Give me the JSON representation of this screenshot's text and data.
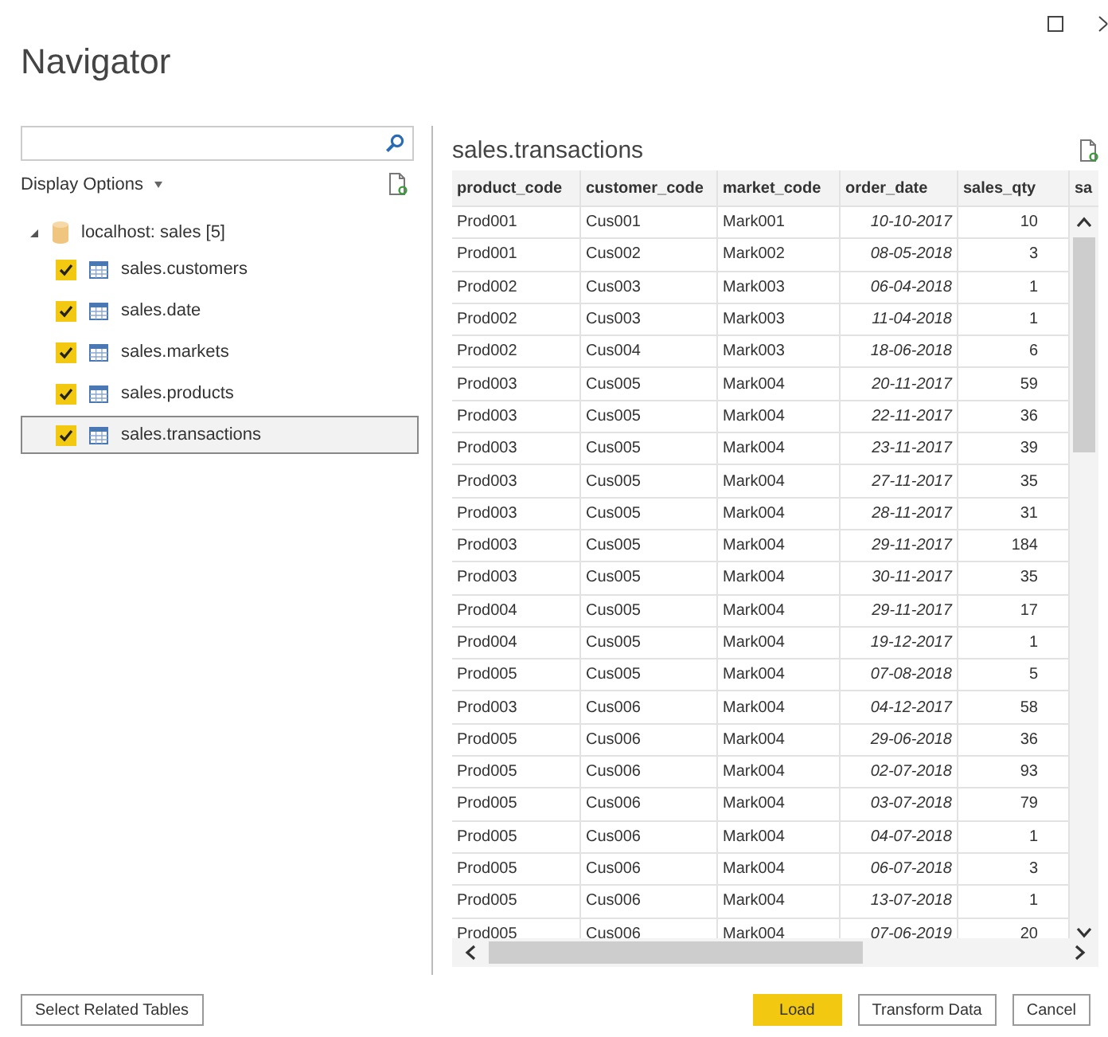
{
  "window": {
    "title": "Navigator"
  },
  "left_panel": {
    "display_options": "Display Options",
    "tree": {
      "label": "localhost: sales [5]",
      "expanded": true,
      "children": [
        {
          "label": "sales.customers",
          "checked": true,
          "selected": false
        },
        {
          "label": "sales.date",
          "checked": true,
          "selected": false
        },
        {
          "label": "sales.markets",
          "checked": true,
          "selected": false
        },
        {
          "label": "sales.products",
          "checked": true,
          "selected": false
        },
        {
          "label": "sales.transactions",
          "checked": true,
          "selected": true
        }
      ]
    }
  },
  "preview": {
    "title": "sales.transactions",
    "table": {
      "columns": [
        "product_code",
        "customer_code",
        "market_code",
        "order_date",
        "sales_qty",
        "sa"
      ],
      "rows": [
        [
          "Prod001",
          "Cus001",
          "Mark001",
          "10-10-2017",
          "10"
        ],
        [
          "Prod001",
          "Cus002",
          "Mark002",
          "08-05-2018",
          "3"
        ],
        [
          "Prod002",
          "Cus003",
          "Mark003",
          "06-04-2018",
          "1"
        ],
        [
          "Prod002",
          "Cus003",
          "Mark003",
          "11-04-2018",
          "1"
        ],
        [
          "Prod002",
          "Cus004",
          "Mark003",
          "18-06-2018",
          "6"
        ],
        [
          "Prod003",
          "Cus005",
          "Mark004",
          "20-11-2017",
          "59"
        ],
        [
          "Prod003",
          "Cus005",
          "Mark004",
          "22-11-2017",
          "36"
        ],
        [
          "Prod003",
          "Cus005",
          "Mark004",
          "23-11-2017",
          "39"
        ],
        [
          "Prod003",
          "Cus005",
          "Mark004",
          "27-11-2017",
          "35"
        ],
        [
          "Prod003",
          "Cus005",
          "Mark004",
          "28-11-2017",
          "31"
        ],
        [
          "Prod003",
          "Cus005",
          "Mark004",
          "29-11-2017",
          "184"
        ],
        [
          "Prod003",
          "Cus005",
          "Mark004",
          "30-11-2017",
          "35"
        ],
        [
          "Prod004",
          "Cus005",
          "Mark004",
          "29-11-2017",
          "17"
        ],
        [
          "Prod004",
          "Cus005",
          "Mark004",
          "19-12-2017",
          "1"
        ],
        [
          "Prod005",
          "Cus005",
          "Mark004",
          "07-08-2018",
          "5"
        ],
        [
          "Prod003",
          "Cus006",
          "Mark004",
          "04-12-2017",
          "58"
        ],
        [
          "Prod005",
          "Cus006",
          "Mark004",
          "29-06-2018",
          "36"
        ],
        [
          "Prod005",
          "Cus006",
          "Mark004",
          "02-07-2018",
          "93"
        ],
        [
          "Prod005",
          "Cus006",
          "Mark004",
          "03-07-2018",
          "79"
        ],
        [
          "Prod005",
          "Cus006",
          "Mark004",
          "04-07-2018",
          "1"
        ],
        [
          "Prod005",
          "Cus006",
          "Mark004",
          "06-07-2018",
          "3"
        ],
        [
          "Prod005",
          "Cus006",
          "Mark004",
          "13-07-2018",
          "1"
        ],
        [
          "Prod005",
          "Cus006",
          "Mark004",
          "07-06-2019",
          "20"
        ]
      ]
    }
  },
  "buttons": [
    {
      "label": "Select Related Tables",
      "kind": "secondary"
    },
    {
      "label": "Load",
      "kind": "primary"
    },
    {
      "label": "Transform Data",
      "kind": "secondary"
    },
    {
      "label": "Cancel",
      "kind": "secondary"
    }
  ]
}
